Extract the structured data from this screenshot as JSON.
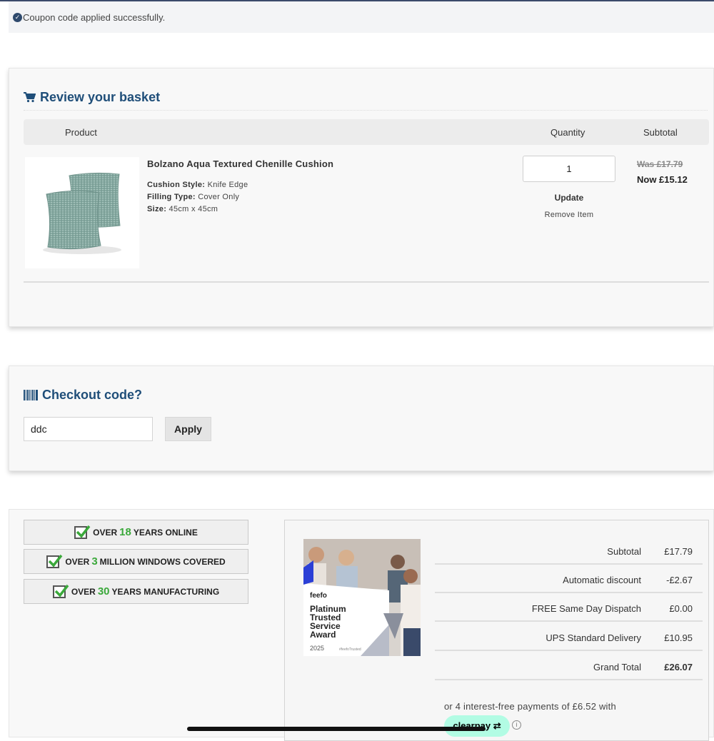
{
  "notice": {
    "text": "Coupon code applied successfully."
  },
  "basket": {
    "title": "Review your basket",
    "headers": {
      "product": "Product",
      "quantity": "Quantity",
      "subtotal": "Subtotal"
    },
    "item": {
      "name": "Bolzano Aqua Textured Chenille Cushion",
      "attrs": [
        {
          "label": "Cushion Style:",
          "value": "Knife Edge"
        },
        {
          "label": "Filling Type:",
          "value": "Cover Only"
        },
        {
          "label": "Size:",
          "value": "45cm x 45cm"
        }
      ],
      "quantity": "1",
      "update_label": "Update",
      "remove_label": "Remove Item",
      "was_price": "Was £17.79",
      "now_price": "Now £15.12",
      "image_color": "#8fb0a8"
    }
  },
  "checkout_code": {
    "title": "Checkout code?",
    "value": "ddc",
    "apply_label": "Apply"
  },
  "trust_badges": [
    {
      "pre": "OVER",
      "num": "18",
      "post": "YEARS ONLINE"
    },
    {
      "pre": "OVER",
      "num": "3",
      "post": "MILLION WINDOWS COVERED"
    },
    {
      "pre": "OVER",
      "num": "30",
      "post": "YEARS MANUFACTURING"
    }
  ],
  "award": {
    "brand": "feefo",
    "line1": "Platinum",
    "line2": "Trusted",
    "line3": "Service",
    "line4": "Award",
    "year": "2025",
    "tag": "#feefoTrusted"
  },
  "summary": {
    "rows": [
      {
        "label": "Subtotal",
        "value": "£17.79"
      },
      {
        "label": "Automatic discount",
        "value": "-£2.67"
      },
      {
        "label": "FREE Same Day Dispatch",
        "value": "£0.00"
      },
      {
        "label": "UPS Standard Delivery",
        "value": "£10.95"
      },
      {
        "label": "Grand Total",
        "value": "£26.07"
      }
    ],
    "clearpay_text": "or 4 interest-free payments of £6.52 with",
    "clearpay_label": "clearpay",
    "clearpay_color": "#b2fce4"
  },
  "colors": {
    "heading": "#1f4e79",
    "accent_green": "#3aa83a"
  }
}
